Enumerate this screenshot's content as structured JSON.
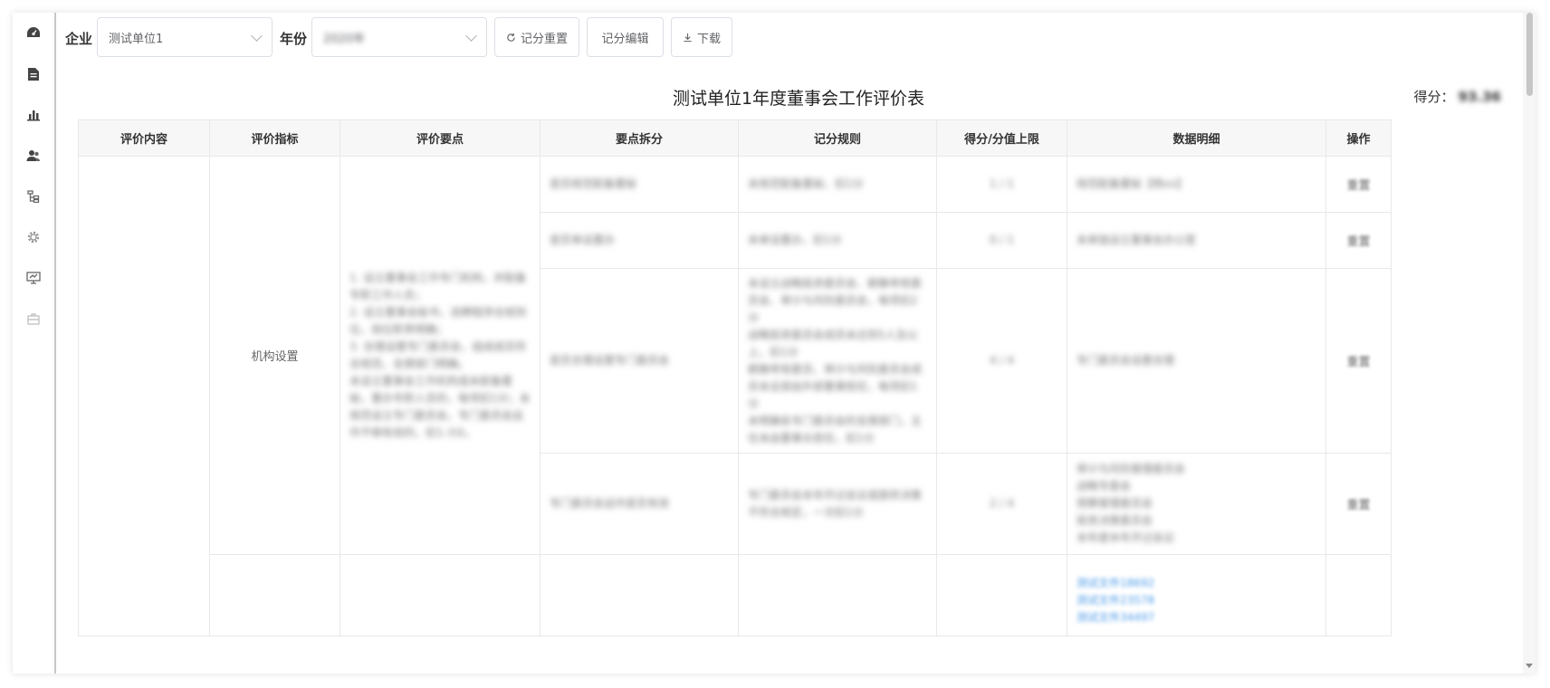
{
  "toolbar": {
    "company_label": "企业",
    "company_value": "测试单位1",
    "year_label": "年份",
    "year_value": "2020年",
    "reset_score_label": "记分重置",
    "edit_score_label": "记分编辑",
    "download_label": "下载"
  },
  "report": {
    "title": "测试单位1年度董事会工作评价表",
    "score_label": "得分：",
    "score_value": "93.36"
  },
  "table": {
    "headers": [
      "评价内容",
      "评价指标",
      "评价要点",
      "要点拆分",
      "记分规则",
      "得分/分值上限",
      "数据明细",
      "操作"
    ],
    "indicator": "机构设置",
    "key_points": "1. 设立董事会工作专门机构，并配备专职工作人员；\n2. 设立董事会秘书，选聘程序合规到位，岗位职责明确；\n3. 合理设置专门委员会，组成成员符合规范，支撑部门明确。\n未设立董事会工作机构或未配备董秘，董办专职人员的，每项扣1分；未规范设立专门委员会，专门委员会运作不够有效的，扣1-3分。",
    "rows": [
      {
        "split": "是否规范配备董秘",
        "rule": "未规范配备董秘，扣1分",
        "score": "1 / 1",
        "detail": "规范配备董秘【杨xx】",
        "action": "重置"
      },
      {
        "split": "是否单设董办",
        "rule": "未单设董办，扣1分",
        "score": "0 / 1",
        "detail": "未单独设立董事会办公室",
        "action": "重置"
      },
      {
        "split": "是否合理设置专门委员会",
        "rule": "未设立战略投资委员会、薪酬考核委员会、审计与风险委员会，每项扣2分\n战略投资委员会成员未达到5人及以上，扣1分\n薪酬考核委员、审计与风险委员会成员未全部由外部董事担任，每项扣1分\n未明确各专门委员会的支撑部门，主任未由董事长担任，扣1分",
        "score": "4 / 4",
        "detail": "专门委员会设置合理",
        "action": "重置"
      },
      {
        "split": "专门委员会运作是否有效",
        "rule": "专门委员会本年开过会议或提供决策不符合规定，一次扣1分",
        "score": "2 / 4",
        "detail": "审计与风险管理委员会\n战略专委会\n预算管理委员会\n投资决策委员会\n本年度本年开过会议",
        "action": "重置"
      }
    ],
    "last_row_links": [
      "测试文件18692",
      "测试文件23578",
      "测试文件34497"
    ]
  },
  "sidebar": {
    "icons": [
      "dashboard-icon",
      "document-icon",
      "bar-chart-icon",
      "users-icon",
      "hierarchy-icon",
      "gear-icon",
      "monitor-icon",
      "briefcase-icon"
    ]
  }
}
